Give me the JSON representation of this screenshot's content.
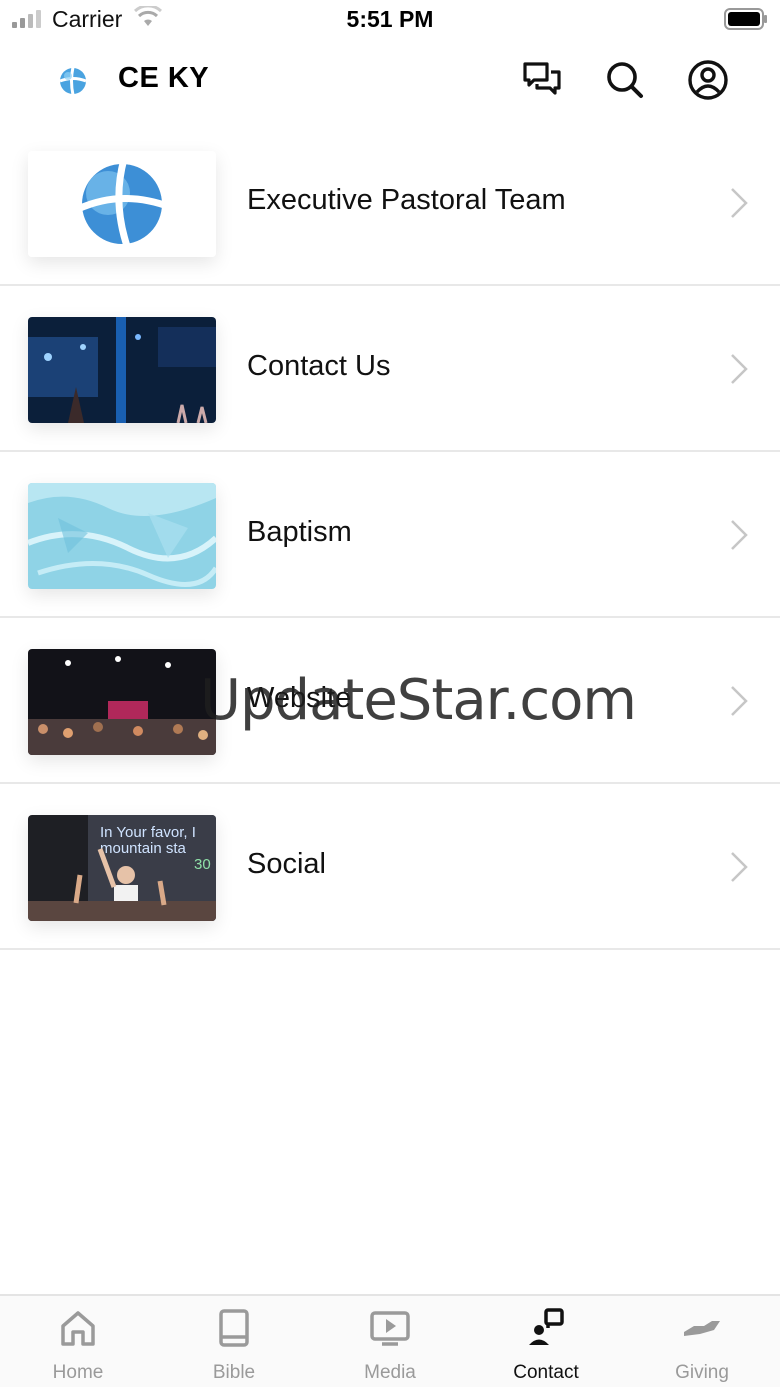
{
  "status_bar": {
    "carrier": "Carrier",
    "time": "5:51 PM"
  },
  "header": {
    "title": "CE KY",
    "icons": [
      "chat-icon",
      "search-icon",
      "profile-icon"
    ]
  },
  "list": {
    "items": [
      {
        "label": "Executive Pastoral Team",
        "thumbnail": "church-logo"
      },
      {
        "label": "Contact Us",
        "thumbnail": "worship-stage"
      },
      {
        "label": "Baptism",
        "thumbnail": "water"
      },
      {
        "label": "Website",
        "thumbnail": "congregation"
      },
      {
        "label": "Social",
        "thumbnail": "preacher"
      }
    ]
  },
  "thumbnail_text": {
    "line1": "In Your favor, I",
    "line2": "mountain sta",
    "line3": "30"
  },
  "watermark": "UpdateStar.com",
  "tab_bar": {
    "tabs": [
      {
        "label": "Home",
        "icon": "home-icon"
      },
      {
        "label": "Bible",
        "icon": "book-icon"
      },
      {
        "label": "Media",
        "icon": "play-icon"
      },
      {
        "label": "Contact",
        "icon": "contact-icon",
        "active": true
      },
      {
        "label": "Giving",
        "icon": "giving-icon"
      }
    ]
  },
  "colors": {
    "accent": "#2a8ad4",
    "inactive": "#9a9a9a",
    "active": "#111111"
  }
}
